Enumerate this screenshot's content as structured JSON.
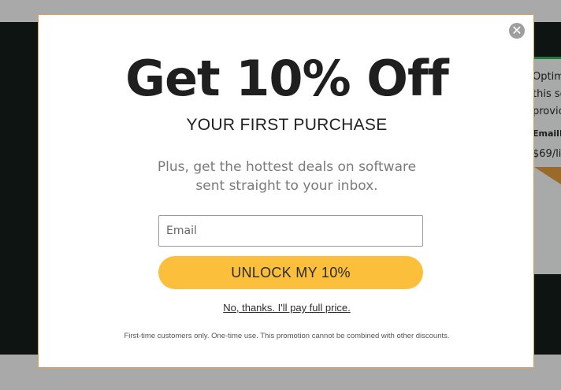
{
  "background": {
    "side_texts": [
      "Optim",
      "this se",
      "provic",
      "EmailD",
      "$69/li"
    ]
  },
  "popup": {
    "close_label": "✕",
    "headline": "Get 10% Off",
    "subheadline": "YOUR FIRST PURCHASE",
    "blurb_line1": "Plus, get the hottest deals on software",
    "blurb_line2": "sent straight to your inbox.",
    "email_placeholder": "Email",
    "email_value": "",
    "cta_label": "UNLOCK MY 10%",
    "decline_label": "No, thanks. I'll pay full price.",
    "fine_print": "First-time customers only. One-time use. This promotion cannot be combined with other discounts."
  },
  "colors": {
    "accent_button": "#fbbf3c",
    "modal_border": "#e3a14f",
    "overlay": "#a9a9a9"
  }
}
